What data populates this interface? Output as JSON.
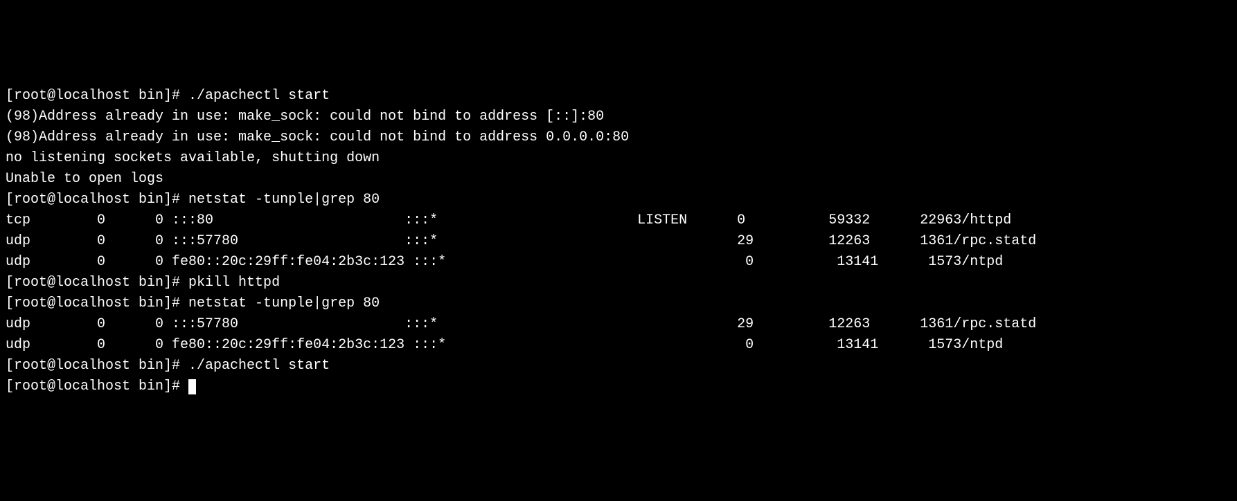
{
  "terminal": {
    "lines": [
      {
        "text": "[root@localhost bin]# ./apachectl start"
      },
      {
        "text": "(98)Address already in use: make_sock: could not bind to address [::]:80"
      },
      {
        "text": "(98)Address already in use: make_sock: could not bind to address 0.0.0.0:80"
      },
      {
        "text": "no listening sockets available, shutting down"
      },
      {
        "text": "Unable to open logs"
      },
      {
        "text": "[root@localhost bin]# netstat -tunple|grep 80"
      },
      {
        "text": "tcp        0      0 :::80                       :::*                        LISTEN      0          59332      22963/httpd"
      },
      {
        "text": "udp        0      0 :::57780                    :::*                                    29         12263      1361/rpc.statd"
      },
      {
        "text": "udp        0      0 fe80::20c:29ff:fe04:2b3c:123 :::*                                    0          13141      1573/ntpd"
      },
      {
        "text": "[root@localhost bin]# pkill httpd"
      },
      {
        "text": "[root@localhost bin]# netstat -tunple|grep 80"
      },
      {
        "text": "udp        0      0 :::57780                    :::*                                    29         12263      1361/rpc.statd"
      },
      {
        "text": "udp        0      0 fe80::20c:29ff:fe04:2b3c:123 :::*                                    0          13141      1573/ntpd"
      },
      {
        "text": "[root@localhost bin]# ./apachectl start"
      },
      {
        "text": "[root@localhost bin]# ",
        "hasCursor": true
      }
    ]
  }
}
